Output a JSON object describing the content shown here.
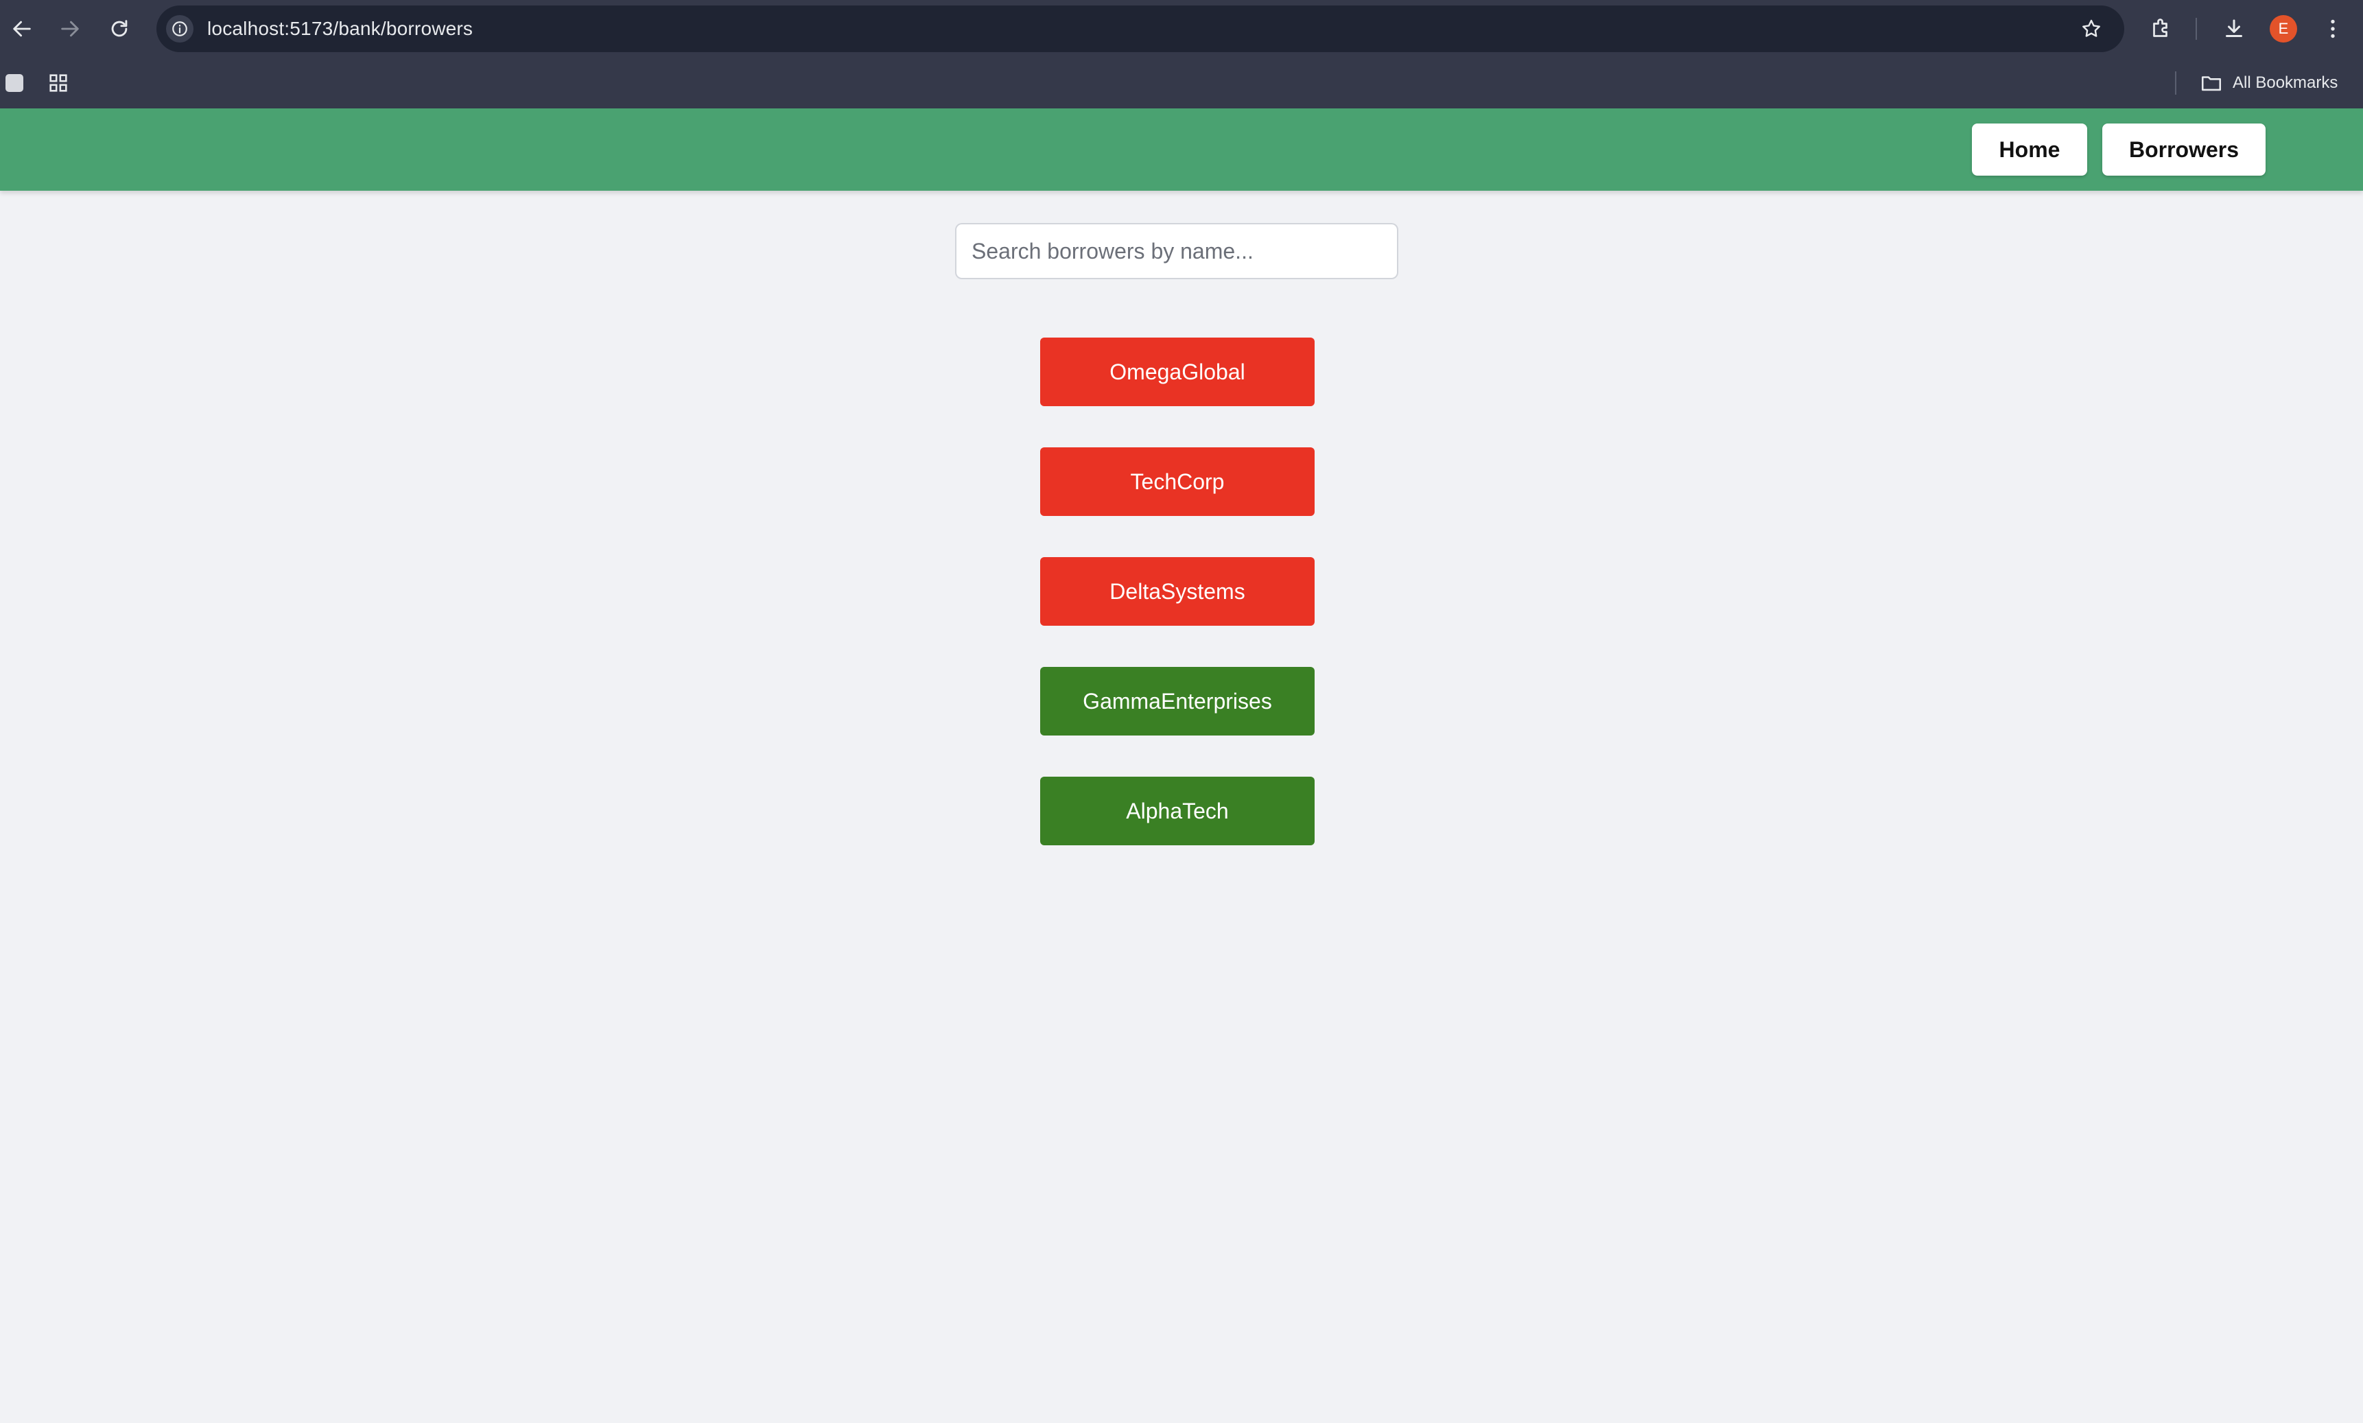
{
  "browser": {
    "url": "localhost:5173/bank/borrowers",
    "profile_initial": "E",
    "bookmarks_label": "All Bookmarks"
  },
  "header": {
    "home_label": "Home",
    "borrowers_label": "Borrowers",
    "color": "#4aa271"
  },
  "search": {
    "placeholder": "Search borrowers by name...",
    "value": ""
  },
  "borrowers": [
    {
      "name": "OmegaGlobal",
      "status_color": "#e93324"
    },
    {
      "name": "TechCorp",
      "status_color": "#e93324"
    },
    {
      "name": "DeltaSystems",
      "status_color": "#e93324"
    },
    {
      "name": "GammaEnterprises",
      "status_color": "#3a8024"
    },
    {
      "name": "AlphaTech",
      "status_color": "#3a8024"
    }
  ]
}
